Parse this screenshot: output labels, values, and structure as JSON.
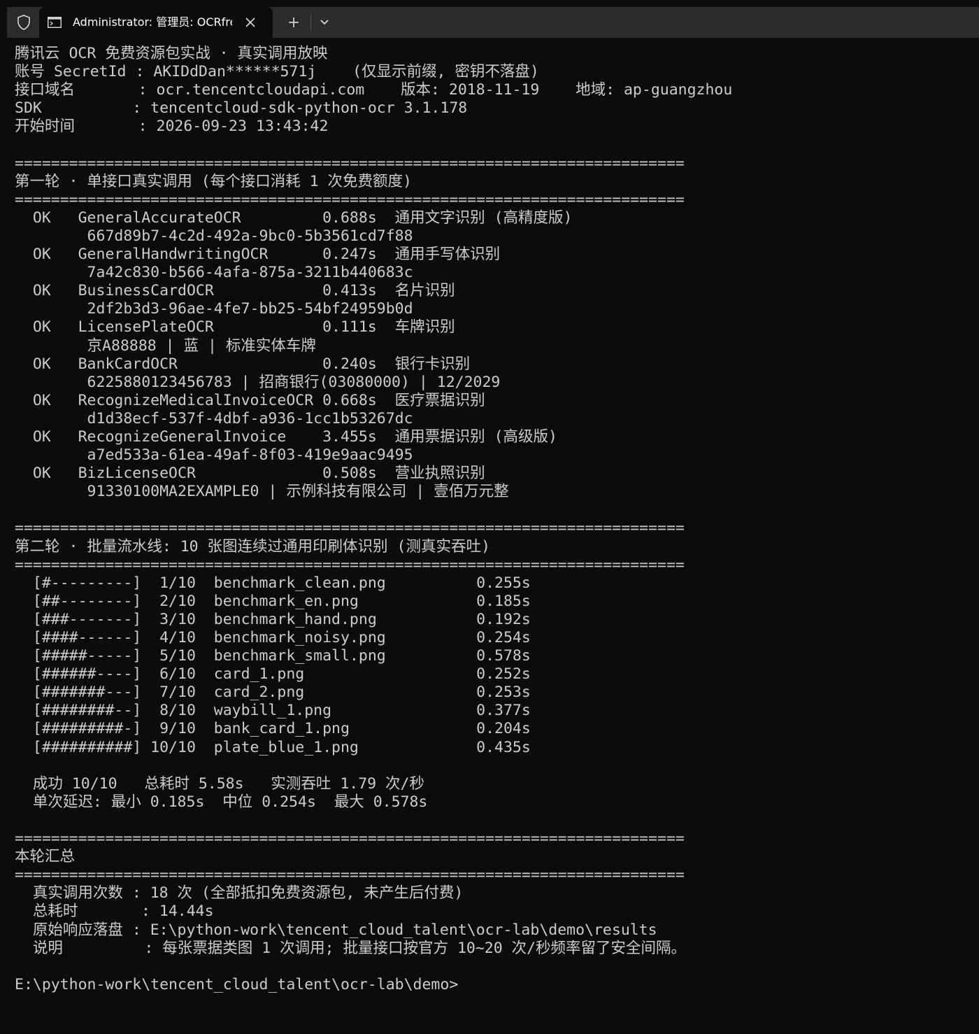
{
  "tab": {
    "title": "Administrator: 管理员:  OCRfree"
  },
  "icons": {
    "shield": "shield-icon",
    "terminal": "terminal-icon",
    "close": "close-icon",
    "plus": "plus-icon",
    "chevron": "chevron-down-icon"
  },
  "colors": {
    "background": "#0c0c0c",
    "titlebar": "#2b2b2b",
    "text": "#cccccc"
  },
  "terminal": {
    "lines": [
      "腾讯云 OCR 免费资源包实战 · 真实调用放映",
      "账号 SecretId : AKIDdDan******571j    (仅显示前缀, 密钥不落盘)",
      "接口域名       : ocr.tencentcloudapi.com    版本: 2018-11-19    地域: ap-guangzhou",
      "SDK          : tencentcloud-sdk-python-ocr 3.1.178",
      "开始时间       : 2026-09-23 13:43:42",
      "",
      "==========================================================================",
      "第一轮 · 单接口真实调用 (每个接口消耗 1 次免费额度)",
      "==========================================================================",
      "  OK   GeneralAccurateOCR         0.688s  通用文字识别 (高精度版)",
      "        667d89b7-4c2d-492a-9bc0-5b3561cd7f88",
      "  OK   GeneralHandwritingOCR      0.247s  通用手写体识别",
      "        7a42c830-b566-4afa-875a-3211b440683c",
      "  OK   BusinessCardOCR            0.413s  名片识别",
      "        2df2b3d3-96ae-4fe7-bb25-54bf24959b0d",
      "  OK   LicensePlateOCR            0.111s  车牌识别",
      "        京A88888 | 蓝 | 标准实体车牌",
      "  OK   BankCardOCR                0.240s  银行卡识别",
      "        6225880123456783 | 招商银行(03080000) | 12/2029",
      "  OK   RecognizeMedicalInvoiceOCR 0.668s  医疗票据识别",
      "        d1d38ecf-537f-4dbf-a936-1cc1b53267dc",
      "  OK   RecognizeGeneralInvoice    3.455s  通用票据识别 (高级版)",
      "        a7ed533a-61ea-49af-8f03-419e9aac9495",
      "  OK   BizLicenseOCR              0.508s  营业执照识别",
      "        91330100MA2EXAMPLE0 | 示例科技有限公司 | 壹佰万元整",
      "",
      "==========================================================================",
      "第二轮 · 批量流水线: 10 张图连续过通用印刷体识别 (测真实吞吐)",
      "==========================================================================",
      "  [#---------]  1/10  benchmark_clean.png          0.255s",
      "  [##--------]  2/10  benchmark_en.png             0.185s",
      "  [###-------]  3/10  benchmark_hand.png           0.192s",
      "  [####------]  4/10  benchmark_noisy.png          0.254s",
      "  [#####-----]  5/10  benchmark_small.png          0.578s",
      "  [######----]  6/10  card_1.png                   0.252s",
      "  [#######---]  7/10  card_2.png                   0.253s",
      "  [########--]  8/10  waybill_1.png                0.377s",
      "  [#########-]  9/10  bank_card_1.png              0.204s",
      "  [##########] 10/10  plate_blue_1.png             0.435s",
      "",
      "  成功 10/10   总耗时 5.58s   实测吞吐 1.79 次/秒",
      "  单次延迟: 最小 0.185s  中位 0.254s  最大 0.578s",
      "",
      "==========================================================================",
      "本轮汇总",
      "==========================================================================",
      "  真实调用次数 : 18 次 (全部抵扣免费资源包, 未产生后付费)",
      "  总耗时       : 14.44s",
      "  原始响应落盘 : E:\\python-work\\tencent_cloud_talent\\ocr-lab\\demo\\results",
      "  说明         : 每张票据类图 1 次调用; 批量接口按官方 10~20 次/秒频率留了安全间隔。",
      "",
      "E:\\python-work\\tencent_cloud_talent\\ocr-lab\\demo>"
    ]
  }
}
